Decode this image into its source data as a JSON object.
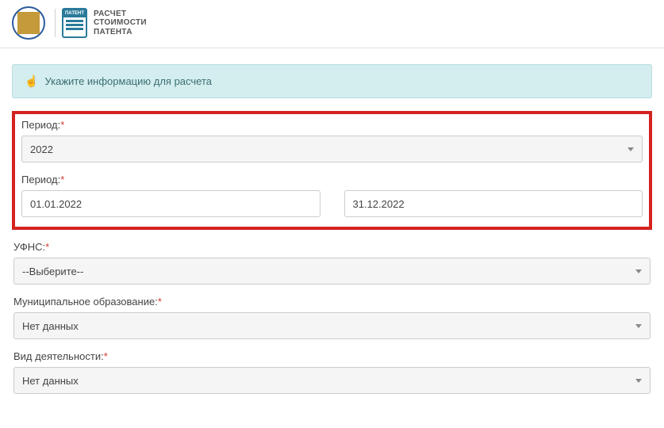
{
  "header": {
    "patent_badge": "ПАТЕНТ",
    "title_line1": "РАСЧЕТ",
    "title_line2": "СТОИМОСТИ",
    "title_line3": "ПАТЕНТА"
  },
  "info_bar": "Укажите информацию для расчета",
  "fields": {
    "period_year": {
      "label": "Период:",
      "value": "2022"
    },
    "period_range": {
      "label": "Период:",
      "start": "01.01.2022",
      "end": "31.12.2022"
    },
    "ufns": {
      "label": "УФНС:",
      "value": "--Выберите--"
    },
    "municipality": {
      "label": "Муниципальное образование:",
      "value": "Нет данных"
    },
    "activity": {
      "label": "Вид деятельности:",
      "value": "Нет данных"
    }
  }
}
